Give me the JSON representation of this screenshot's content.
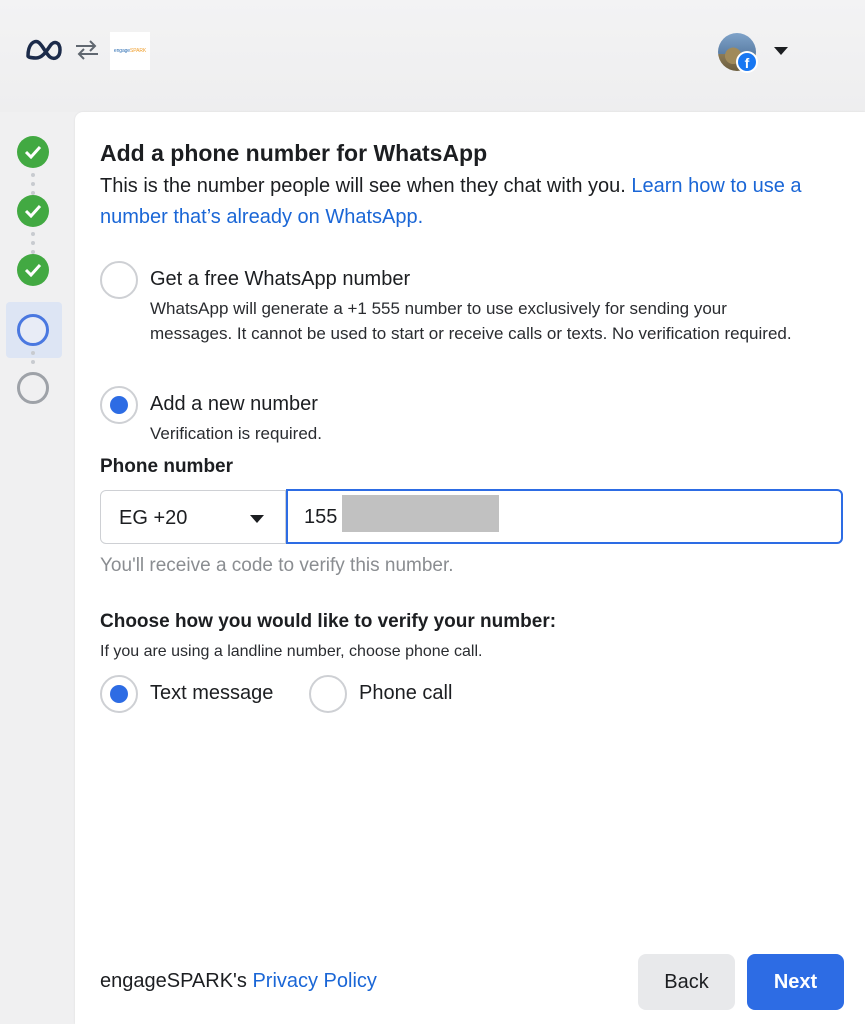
{
  "header": {
    "meta_logo": "meta-logo",
    "swap_icon": "swap-icon",
    "partner_logo_text_a": "engage",
    "partner_logo_text_b": "SPARK",
    "avatar_badge": "f"
  },
  "stepper": {
    "steps": [
      "done",
      "done",
      "done",
      "current",
      "pending"
    ]
  },
  "form": {
    "title": "Add a phone number for WhatsApp",
    "subtitle": "This is the number people will see when they chat with you.",
    "subtitle_link": "Learn how to use a number that’s already on WhatsApp.",
    "option_free": {
      "title": "Get a free WhatsApp number",
      "description": "WhatsApp will generate a +1 555 number to use exclusively for sending your messages. It cannot be used to start or receive calls or texts. No verification required.",
      "selected": false
    },
    "option_new": {
      "title": "Add a new number",
      "description": "Verification is required.",
      "selected": true
    },
    "phone_label": "Phone number",
    "country_code": "EG +20",
    "phone_value": "155",
    "phone_hint": "You'll receive a code to verify this number.",
    "verify_heading": "Choose how you would like to verify your number:",
    "verify_note": "If you are using a landline number, choose phone call.",
    "verify_options": [
      {
        "label": "Text message",
        "selected": true
      },
      {
        "label": "Phone call",
        "selected": false
      }
    ]
  },
  "footer": {
    "policy_prefix": "engageSPARK's",
    "policy_link": "Privacy Policy",
    "back_label": "Back",
    "next_label": "Next"
  },
  "colors": {
    "accent": "#2d6ce4",
    "link": "#1a66d6",
    "done": "#42a942"
  }
}
